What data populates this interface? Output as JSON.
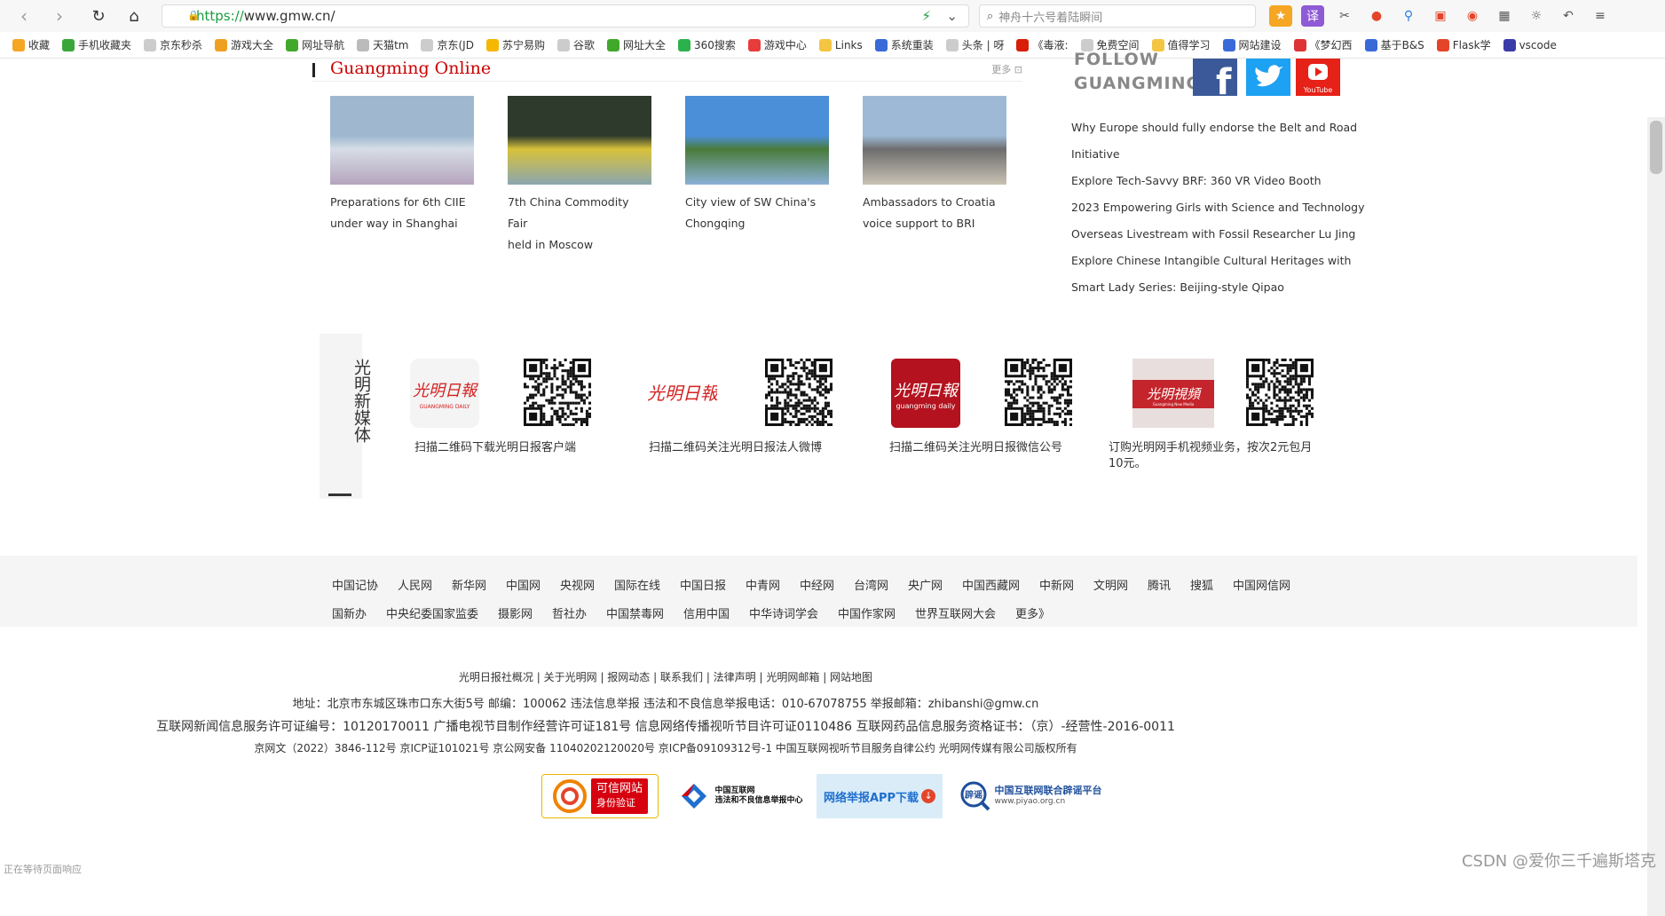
{
  "browser": {
    "url_scheme": "https://",
    "url_host": "www.gmw.cn/",
    "search_placeholder": "神舟十六号着陆瞬间",
    "bookmarks": [
      {
        "label": "收藏",
        "color": "#f5a623"
      },
      {
        "label": "手机收藏夹",
        "color": "#3aa639"
      },
      {
        "label": "京东秒杀",
        "color": "#cccccc"
      },
      {
        "label": "游戏大全",
        "color": "#f0a020"
      },
      {
        "label": "网址导航",
        "color": "#41a82b"
      },
      {
        "label": "天猫tm",
        "color": "#bbbbbb"
      },
      {
        "label": "京东(JD",
        "color": "#cccccc"
      },
      {
        "label": "苏宁易购",
        "color": "#f5b700"
      },
      {
        "label": "谷歌",
        "color": "#cccccc"
      },
      {
        "label": "网址大全",
        "color": "#41a82b"
      },
      {
        "label": "360搜索",
        "color": "#2bb24c"
      },
      {
        "label": "游戏中心",
        "color": "#e83b3b"
      },
      {
        "label": "Links",
        "color": "#f4c542"
      },
      {
        "label": "系统重装",
        "color": "#3a6ad8"
      },
      {
        "label": "头条 | 呀",
        "color": "#cccccc"
      },
      {
        "label": "《毒液:",
        "color": "#d81e06"
      },
      {
        "label": "免费空间",
        "color": "#cccccc"
      },
      {
        "label": "值得学习",
        "color": "#f4c542"
      },
      {
        "label": "网站建设",
        "color": "#3a6ad8"
      },
      {
        "label": "《梦幻西",
        "color": "#d33"
      },
      {
        "label": "基于B&S",
        "color": "#3a6ad8"
      },
      {
        "label": "Flask学",
        "color": "#e4452a"
      },
      {
        "label": "vscode",
        "color": "#3a3aa8"
      }
    ]
  },
  "guangming_online": {
    "title": "Guangming Online",
    "more": "更多",
    "news": [
      {
        "caption_l1": "Preparations for 6th CIIE",
        "caption_l2": "under way in Shanghai",
        "colors": [
          "#9fb8cf",
          "#d6dde6",
          "#b6a4bd"
        ]
      },
      {
        "caption_l1": "7th China Commodity Fair",
        "caption_l2": "held in Moscow",
        "colors": [
          "#2e3a2c",
          "#d8c23a",
          "#8aa6b0"
        ]
      },
      {
        "caption_l1": "City view of SW China's",
        "caption_l2": "Chongqing",
        "colors": [
          "#4b8fd8",
          "#4a7b3a",
          "#8bb0d8"
        ]
      },
      {
        "caption_l1": "Ambassadors to Croatia",
        "caption_l2": "voice support to BRI",
        "colors": [
          "#9db9d6",
          "#6d6d6d",
          "#c9c2b4"
        ]
      }
    ]
  },
  "follow": {
    "title_l1": "FOLLOW",
    "title_l2": "GUANGMING",
    "links": [
      "Why Europe should fully endorse the Belt and Road",
      "Initiative",
      "Explore Tech-Savvy BRF: 360 VR Video Booth",
      "2023 Empowering Girls with Science and Technology",
      "Overseas Livestream with Fossil Researcher Lu Jing",
      "Explore Chinese Intangible Cultural Heritages with",
      "Smart Lady Series: Beijing-style Qipao"
    ]
  },
  "new_media": {
    "title": "光明新媒体",
    "items": [
      {
        "caption": "扫描二维码下载光明日报客户端"
      },
      {
        "caption": "扫描二维码关注光明日报法人微博"
      },
      {
        "caption": "扫描二维码关注光明日报微信公号"
      },
      {
        "caption_l1": "订购光明网手机视频业务，按次2元包月",
        "caption_l2": "10元。"
      }
    ]
  },
  "friend_links": {
    "row1": [
      "中国记协",
      "人民网",
      "新华网",
      "中国网",
      "央视网",
      "国际在线",
      "中国日报",
      "中青网",
      "中经网",
      "台湾网",
      "央广网",
      "中国西藏网",
      "中新网",
      "文明网",
      "腾讯",
      "搜狐",
      "中国网信网"
    ],
    "row2": [
      "国新办",
      "中央纪委国家监委",
      "摄影网",
      "哲社办",
      "中国禁毒网",
      "信用中国",
      "中华诗词学会",
      "中国作家网",
      "世界互联网大会",
      "更多》"
    ]
  },
  "footer": {
    "links": [
      "光明日报社概况",
      "关于光明网",
      "报网动态",
      "联系我们",
      "法律声明",
      "光明网邮箱",
      "网站地图"
    ],
    "address_line": "地址：北京市东城区珠市口东大街5号  邮编：100062  违法信息举报  违法和不良信息举报电话：010-67078755  举报邮箱：zhibanshi@gmw.cn",
    "license_line": "互联网新闻信息服务许可证编号：10120170011  广播电视节目制作经营许可证181号  信息网络传播视听节目许可证0110486  互联网药品信息服务资格证书：（京）-经营性-2016-0011",
    "icp_line": "京网文（2022）3846-112号  京ICP证101021号  京公网安备 11040202120020号  京ICP备09109312号-1  中国互联网视听节目服务自律公约  光明网传媒有限公司版权所有",
    "badges": [
      {
        "l1": "可信网站",
        "l2": "身份验证"
      },
      {
        "l1": "中国互联网",
        "l2": "违法和不良信息举报中心"
      },
      {
        "l1": "网络举报APP下载"
      },
      {
        "l1": "辟谣",
        "l2": "中国互联网联合辟谣平台",
        "l3": "www.piyao.org.cn"
      }
    ]
  },
  "watermark": "CSDN @爱你三千遍斯塔克",
  "status_text": "正在等待页面响应"
}
